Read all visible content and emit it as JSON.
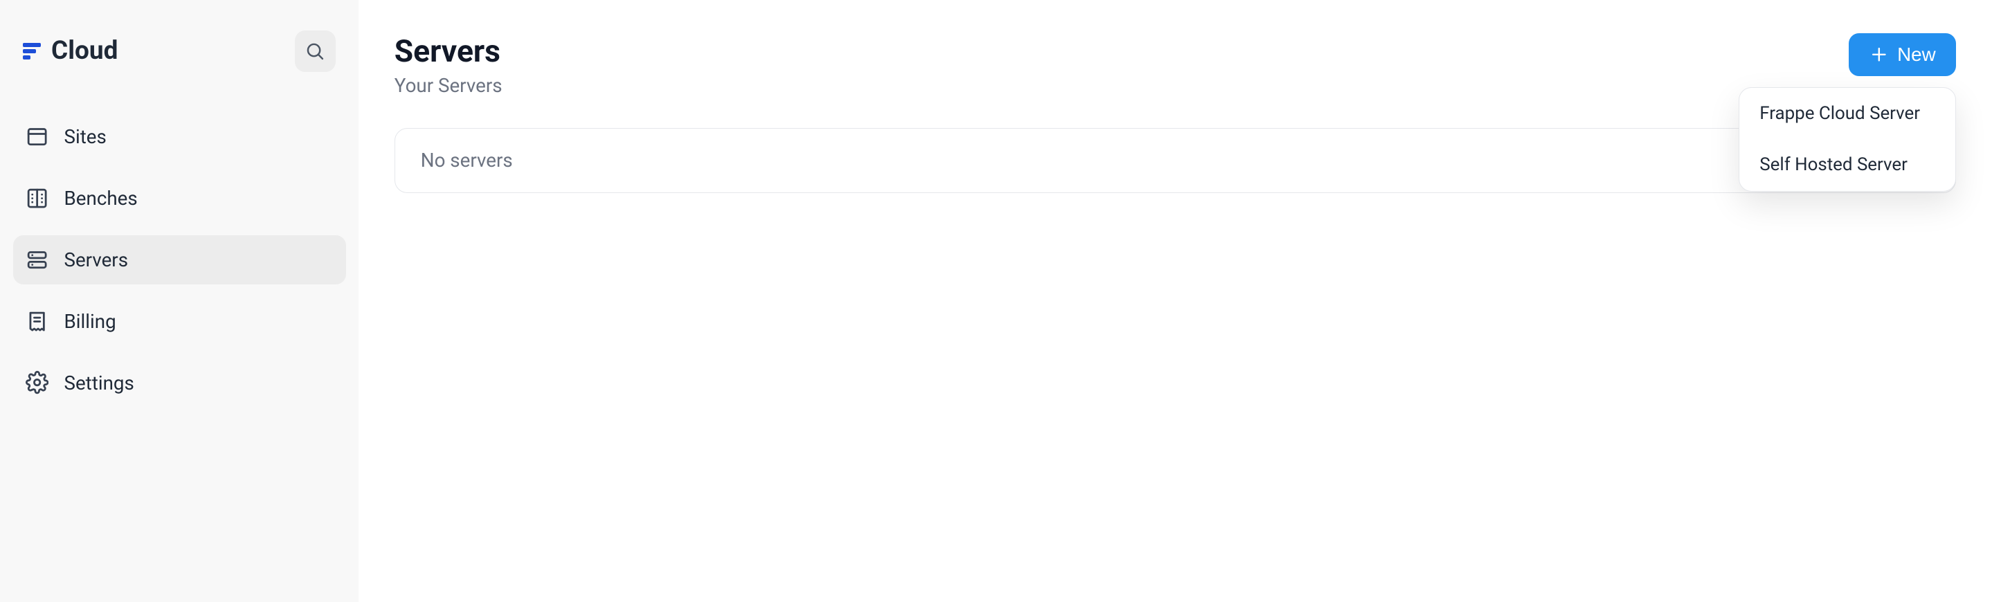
{
  "brand": {
    "name": "Cloud"
  },
  "sidebar": {
    "items": [
      {
        "label": "Sites",
        "icon": "browser-icon",
        "active": false
      },
      {
        "label": "Benches",
        "icon": "columns-icon",
        "active": false
      },
      {
        "label": "Servers",
        "icon": "stack-icon",
        "active": true
      },
      {
        "label": "Billing",
        "icon": "receipt-icon",
        "active": false
      },
      {
        "label": "Settings",
        "icon": "gear-icon",
        "active": false
      }
    ]
  },
  "header": {
    "title": "Servers",
    "subtitle": "Your Servers",
    "new_button_label": "New"
  },
  "content": {
    "empty_message": "No servers"
  },
  "dropdown": {
    "items": [
      {
        "label": "Frappe Cloud Server"
      },
      {
        "label": "Self Hosted Server"
      }
    ]
  }
}
